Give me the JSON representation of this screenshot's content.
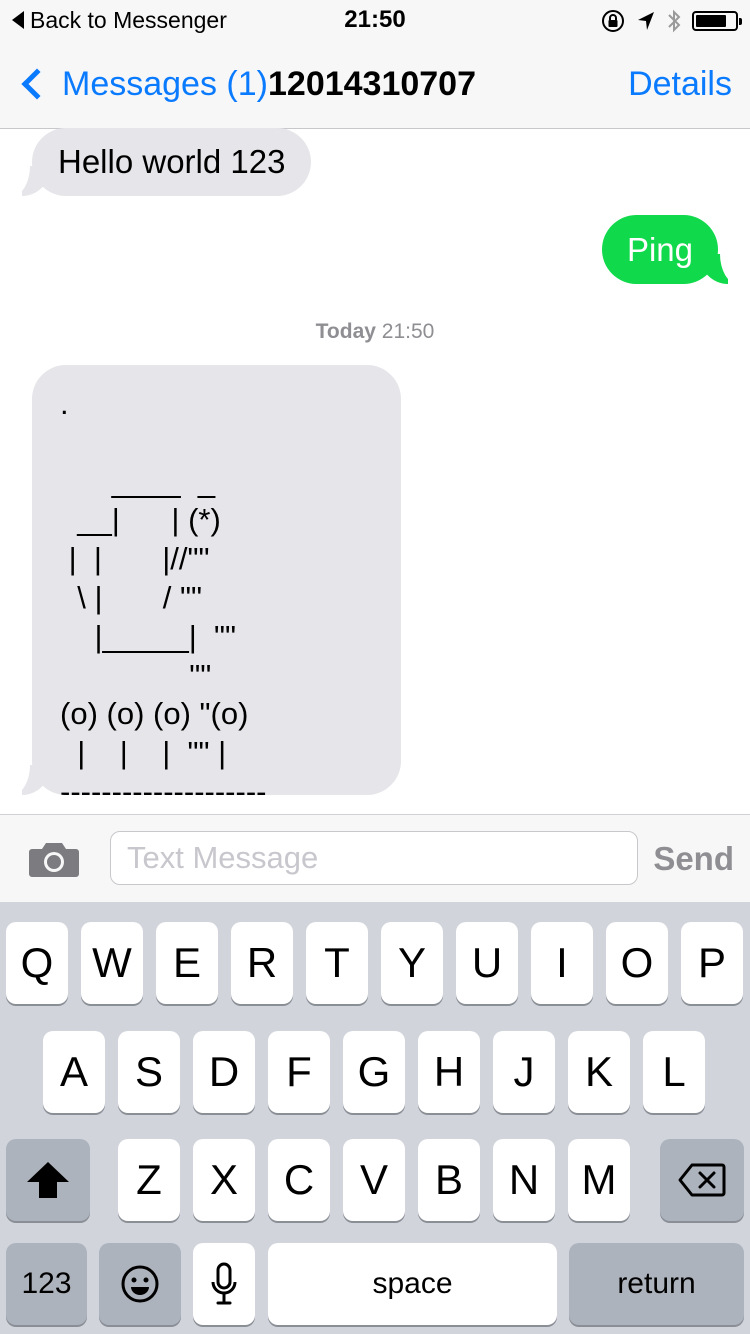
{
  "status_bar": {
    "back_label": "Back to Messenger",
    "time": "21:50",
    "icons": [
      "orientation-lock-icon",
      "location-arrow-icon",
      "bluetooth-icon",
      "battery-icon"
    ],
    "battery_level": 0.8
  },
  "nav": {
    "back_label": "Messages (1)",
    "title": "12014310707",
    "details_label": "Details",
    "accent_color": "#0a7aff"
  },
  "messages": [
    {
      "direction": "incoming",
      "text": "Hello world 123"
    },
    {
      "direction": "outgoing",
      "text": "Ping"
    },
    {
      "direction": "incoming",
      "text": ".\n\n      ____  _\n  __|      | (*)\n |  |       |//\"\"\n  \\ |       / \"\"\n    |_____|  \"\"\n               \"\"\n(o) (o) (o) \"(o)\n  |    |    |  \"\" |\n--------------------"
    }
  ],
  "timestamp": {
    "day": "Today",
    "time": "21:50"
  },
  "input": {
    "placeholder": "Text Message",
    "value": "",
    "send_label": "Send"
  },
  "colors": {
    "incoming_bubble": "#e5e5ea",
    "outgoing_bubble": "#11d94c",
    "keyboard_bg": "#d1d5db"
  },
  "keyboard": {
    "row1": [
      "Q",
      "W",
      "E",
      "R",
      "T",
      "Y",
      "U",
      "I",
      "O",
      "P"
    ],
    "row2": [
      "A",
      "S",
      "D",
      "F",
      "G",
      "H",
      "J",
      "K",
      "L"
    ],
    "row3": [
      "Z",
      "X",
      "C",
      "V",
      "B",
      "N",
      "M"
    ],
    "numbers_label": "123",
    "space_label": "space",
    "return_label": "return",
    "shift_icon": "shift-icon",
    "delete_icon": "backspace-icon",
    "emoji_icon": "emoji-icon",
    "mic_icon": "microphone-icon"
  }
}
